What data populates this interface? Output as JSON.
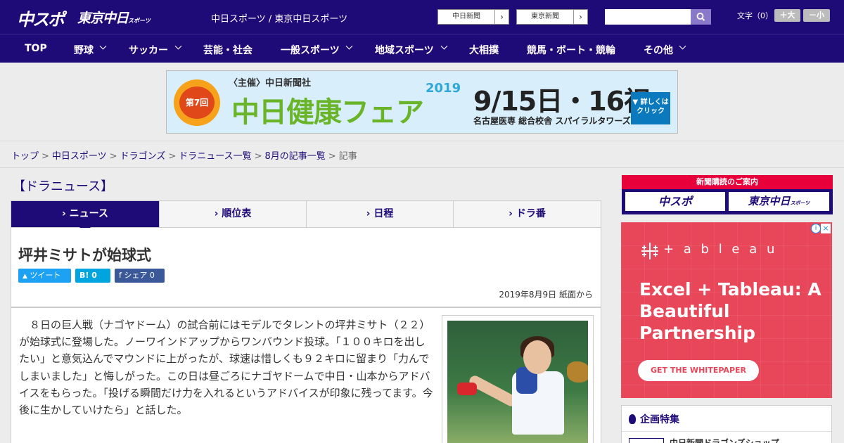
{
  "header": {
    "logo_chuspo": "中スポ",
    "logo_tokyo": "東京中日",
    "logo_tokyo_sub": "スポーツ",
    "site_link": "中日スポーツ / 東京中日スポーツ",
    "paper_buttons": [
      {
        "label": "中日新聞",
        "arrow": "›"
      },
      {
        "label": "東京新聞",
        "arrow": "›"
      }
    ],
    "search_placeholder": "",
    "font_size_label": "文字（0）",
    "font_plus": "＋大",
    "font_minus": "－小"
  },
  "nav": {
    "items": [
      {
        "label": "TOP"
      },
      {
        "label": "野球"
      },
      {
        "label": "サッカー"
      },
      {
        "label": "芸能・社会"
      },
      {
        "label": "一般スポーツ"
      },
      {
        "label": "地域スポーツ"
      },
      {
        "label": "大相撲"
      },
      {
        "label": "競馬・ボート・競輪"
      },
      {
        "label": "その他"
      }
    ]
  },
  "banner": {
    "edition": "第7回",
    "organizer": "〈主催〉中日新聞社",
    "title": "中日健康フェア",
    "year": "2019",
    "date": "9/15日・16祝",
    "venue": "名古屋医専 総合校舎 スパイラルタワーズ",
    "details": "▼ 詳しくは クリック"
  },
  "breadcrumb": {
    "items": [
      "トップ",
      "中日スポーツ",
      "ドラゴンズ",
      "ドラニュース一覧",
      "8月の記事一覧"
    ],
    "current": "記事",
    "sep": ">"
  },
  "main": {
    "section_title": "【ドラニュース】",
    "tabs": [
      {
        "label": "› ニュース"
      },
      {
        "label": "› 順位表"
      },
      {
        "label": "› 日程"
      },
      {
        "label": "› ドラ番"
      }
    ],
    "article": {
      "title": "坪井ミサトが始球式",
      "tweet": "ツイート",
      "hatena": "B! 0",
      "share": "f シェア 0",
      "date": "2019年8月9日 紙面から",
      "body": "８日の巨人戦（ナゴヤドーム）の試合前にはモデルでタレントの坪井ミサト（２２）が始球式に登場した。ノーワインドアップからワンバウンド投球。「１００キロを出したい」と意気込んでマウンドに上がったが、球速は惜しくも９２キロに留まり「力んでしまいました」と悔しがった。この日は昼ごろにナゴヤドームで中日・山本からアドバイスをもらった。「投げる瞬間だけ力を入れるというアドバイスが印象に残ってます。今後に生かしていけたら」と話した。"
    }
  },
  "sidebar": {
    "subscribe": {
      "bar": "新聞購読のご案内",
      "b1": "中スポ",
      "b2": "東京中日",
      "b2_sub": "スポーツ"
    },
    "ad": {
      "brand": "+ a b l e a u",
      "headline": "Excel + Tableau: A Beautiful Partnership",
      "cta": "GET THE WHITEPAPER",
      "info": "i",
      "close": "×"
    },
    "feature": {
      "heading": "企画特集",
      "item": "中日新聞ドラゴンズショップ"
    }
  },
  "colors": {
    "brand_navy": "#1f0b78",
    "tableau_red": "#e8475a",
    "subscribe_red": "#e8003a"
  }
}
